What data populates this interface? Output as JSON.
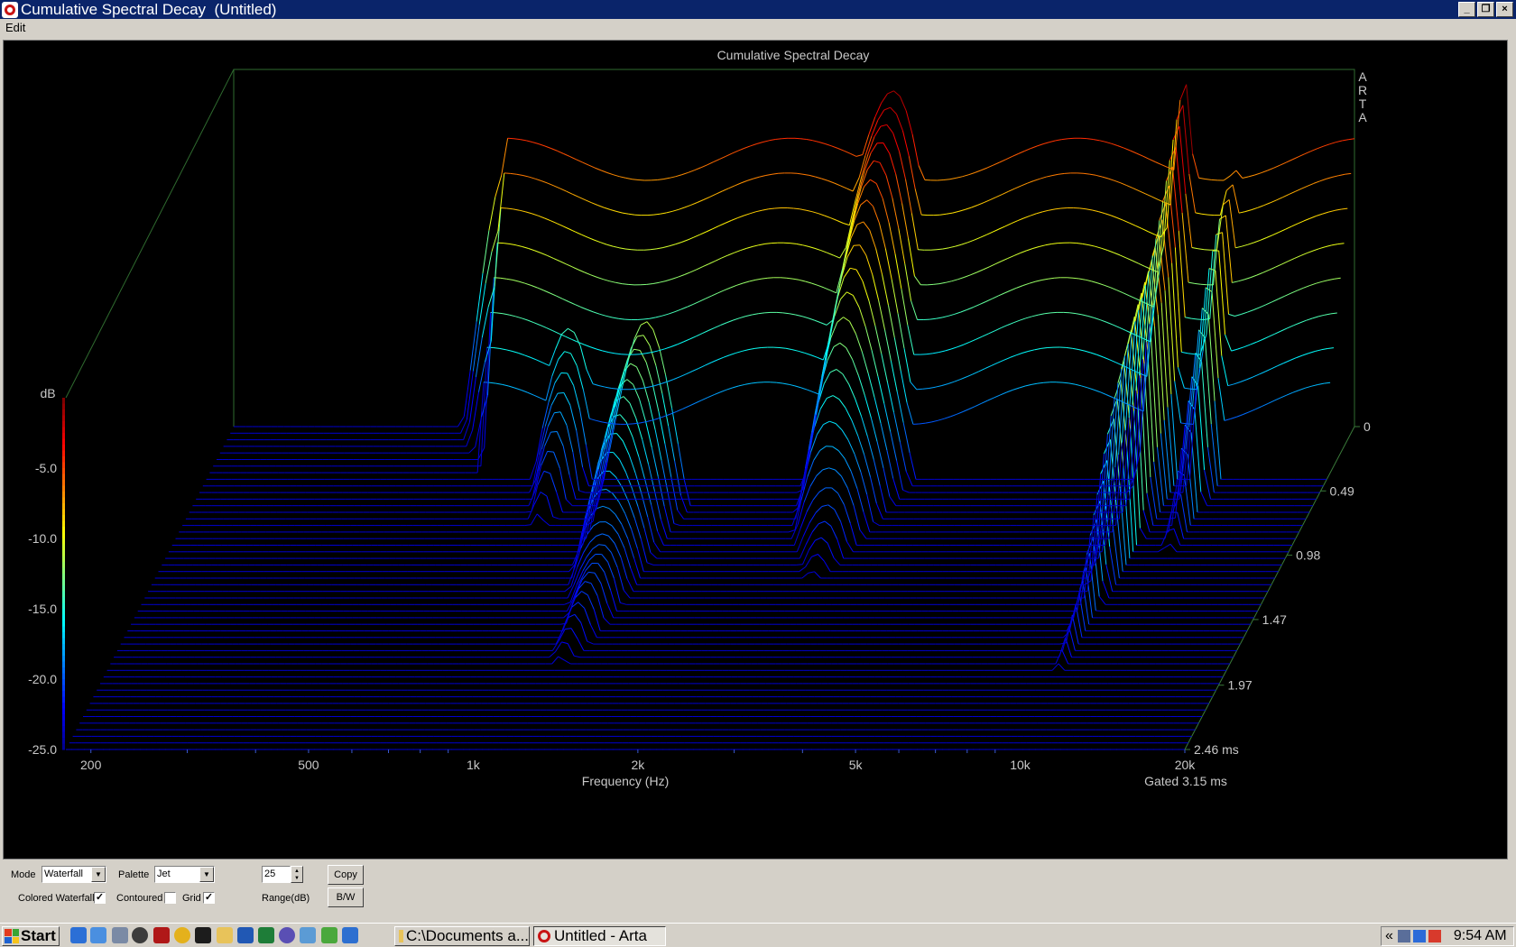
{
  "window": {
    "title": "Cumulative Spectral Decay  (Untitled)",
    "min_glyph": "0",
    "max_glyph": "1",
    "close_glyph": "×"
  },
  "menu": {
    "edit": "Edit"
  },
  "chart_data": {
    "type": "waterfall",
    "title": "Cumulative Spectral Decay",
    "watermark": "ARTA",
    "xlabel": "Frequency (Hz)",
    "x_ticks": [
      "200",
      "500",
      "1k",
      "2k",
      "5k",
      "10k",
      "20k"
    ],
    "x_tick_values": [
      200,
      500,
      1000,
      2000,
      5000,
      10000,
      20000
    ],
    "x_scale": "log",
    "xlim": [
      180,
      20000
    ],
    "zlabel": "dB",
    "z_ticks": [
      "-5.0",
      "-10.0",
      "-15.0",
      "-20.0",
      "-25.0"
    ],
    "zlim": [
      -25,
      0
    ],
    "z_top_value": 0,
    "time_ticks": [
      "0",
      "0.49",
      "0.98",
      "1.47",
      "1.97",
      "2.46 ms"
    ],
    "time_tick_values": [
      0,
      0.49,
      0.98,
      1.47,
      1.97,
      2.46
    ],
    "time_unit": "ms",
    "gated_label": "Gated 3.15 ms",
    "palette": "Jet",
    "slices": 50,
    "features": [
      {
        "freq": 580,
        "level_db": -6,
        "onset_ms": 0,
        "decay_ms": 0.4,
        "description": "low frequency shelf"
      },
      {
        "freq": 800,
        "level_db": -14,
        "onset_ms": 0.3,
        "decay_ms": 1.0
      },
      {
        "freq": 1200,
        "level_db": -13,
        "onset_ms": 0.6,
        "decay_ms": 2.4
      },
      {
        "freq": 2800,
        "level_db": -1,
        "onset_ms": 0,
        "decay_ms": 1.2
      },
      {
        "freq": 9800,
        "level_db": -1,
        "onset_ms": 0,
        "decay_ms": 1.9
      },
      {
        "freq": 12000,
        "level_db": -6,
        "onset_ms": 0,
        "decay_ms": 1.4
      },
      {
        "freq": 16500,
        "level_db": -12,
        "onset_ms": 0.1,
        "decay_ms": 0.5
      }
    ]
  },
  "controls": {
    "mode_label": "Mode",
    "mode_value": "Waterfall",
    "palette_label": "Palette",
    "palette_value": "Jet",
    "range_value": "25",
    "range_label": "Range(dB)",
    "copy_label": "Copy",
    "bw_label": "B/W",
    "colored_waterfall_label": "Colored Waterfall",
    "colored_waterfall_checked": "✓",
    "contoured_label": "Contoured",
    "contoured_checked": "",
    "grid_label": "Grid",
    "grid_checked": "✓"
  },
  "taskbar": {
    "start_label": "Start",
    "tasks": [
      {
        "label": "C:\\Documents a...",
        "icon": "folder-icon"
      },
      {
        "label": "Untitled - Arta",
        "icon": "arta-icon",
        "active": true
      }
    ],
    "tray_collapse": "«",
    "clock": "9:54 AM"
  }
}
